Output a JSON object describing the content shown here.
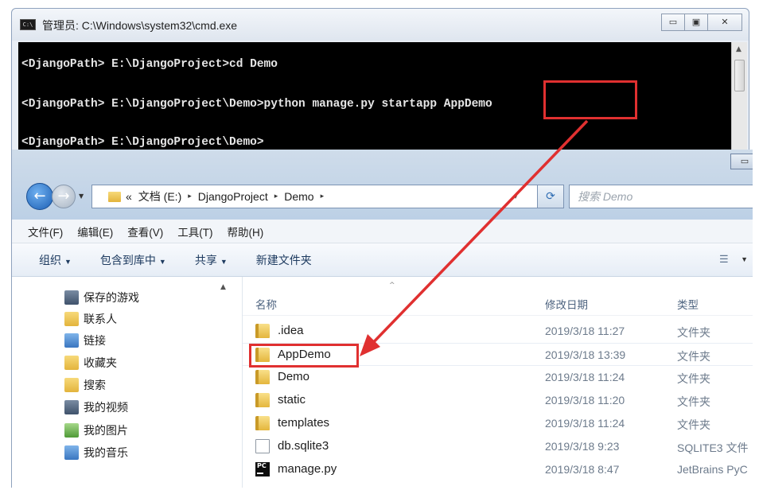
{
  "cmd": {
    "title": "管理员: C:\\Windows\\system32\\cmd.exe",
    "icon_label": "C:\\",
    "buttons": {
      "minimize": "▭",
      "maximize": "▣",
      "close": "✕"
    },
    "lines": [
      "<DjangoPath> E:\\DjangoProject>cd Demo",
      "<DjangoPath> E:\\DjangoProject\\Demo>python manage.py startapp AppDemo",
      "<DjangoPath> E:\\DjangoProject\\Demo>"
    ]
  },
  "explorer": {
    "min_button": "▭",
    "address": {
      "prefix": "«",
      "segments": [
        "文档 (E:)",
        "DjangoProject",
        "Demo"
      ],
      "separator": "▸",
      "dropdown": "▾"
    },
    "refresh_glyph": "⟳",
    "search_placeholder": "搜索 Demo",
    "menu": [
      "文件(F)",
      "编辑(E)",
      "查看(V)",
      "工具(T)",
      "帮助(H)"
    ],
    "toolbar": {
      "organize": "组织",
      "include_library": "包含到库中",
      "share": "共享",
      "new_folder": "新建文件夹",
      "caret": "▼"
    },
    "nav_pane": {
      "items": [
        {
          "label": "保存的游戏",
          "icon": "saved-games-icon"
        },
        {
          "label": "联系人",
          "icon": "contacts-icon"
        },
        {
          "label": "链接",
          "icon": "links-icon"
        },
        {
          "label": "收藏夹",
          "icon": "favorites-icon"
        },
        {
          "label": "搜索",
          "icon": "searches-icon"
        },
        {
          "label": "我的视频",
          "icon": "videos-icon"
        },
        {
          "label": "我的图片",
          "icon": "pictures-icon"
        },
        {
          "label": "我的音乐",
          "icon": "music-icon"
        }
      ]
    },
    "columns": {
      "name": "名称",
      "date": "修改日期",
      "type": "类型"
    },
    "files": [
      {
        "name": ".idea",
        "date": "2019/3/18 11:27",
        "type": "文件夹",
        "icon": "folder-icon"
      },
      {
        "name": "AppDemo",
        "date": "2019/3/18 13:39",
        "type": "文件夹",
        "icon": "folder-icon"
      },
      {
        "name": "Demo",
        "date": "2019/3/18 11:24",
        "type": "文件夹",
        "icon": "folder-icon"
      },
      {
        "name": "static",
        "date": "2019/3/18 11:20",
        "type": "文件夹",
        "icon": "folder-icon"
      },
      {
        "name": "templates",
        "date": "2019/3/18 11:24",
        "type": "文件夹",
        "icon": "folder-icon"
      },
      {
        "name": "db.sqlite3",
        "date": "2019/3/18 9:23",
        "type": "SQLITE3 文件",
        "icon": "document-icon"
      },
      {
        "name": "manage.py",
        "date": "2019/3/18 8:47",
        "type": "JetBrains PyC",
        "icon": "pycharm-icon"
      }
    ]
  },
  "colors": {
    "highlight": "#e03030",
    "cmd_bg": "#000000",
    "cmd_text": "#e6e6e6"
  }
}
